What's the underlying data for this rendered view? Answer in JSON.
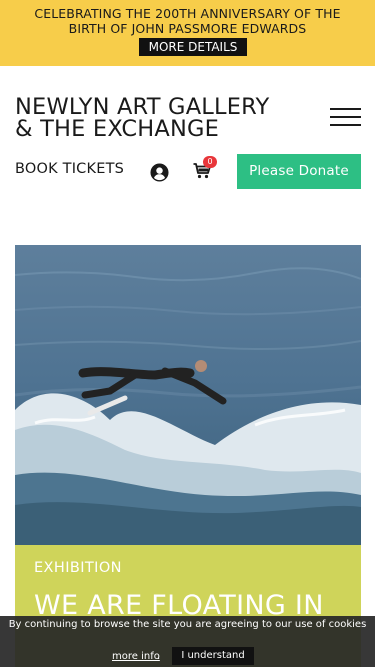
{
  "announcement": {
    "line1": "CELEBRATING THE 200TH ANNIVERSARY OF THE",
    "line2": "BIRTH OF JOHN PASSMORE EDWARDS",
    "button_label": "MORE DETAILS"
  },
  "header": {
    "logo_line1": "NEWLYN ART GALLERY",
    "logo_line2": "& THE EXCHANGE",
    "book_tickets": "BOOK TICKETS",
    "cart_count": "0",
    "donate_label": "Please Donate",
    "icons": [
      "menu-icon",
      "user-icon",
      "cart-icon"
    ]
  },
  "hero": {
    "category": "EXHIBITION",
    "title": "WE ARE FLOATING IN"
  },
  "cookie_notice": {
    "message": "By continuing to browse the site you are agreeing to our use of cookies",
    "link_label": "more info",
    "separator": ".",
    "accept_label": "I understand"
  },
  "colors": {
    "banner": "#f7cd4a",
    "donate": "#2dbf84",
    "card": "#cfd45a",
    "badge": "#e8363a"
  }
}
